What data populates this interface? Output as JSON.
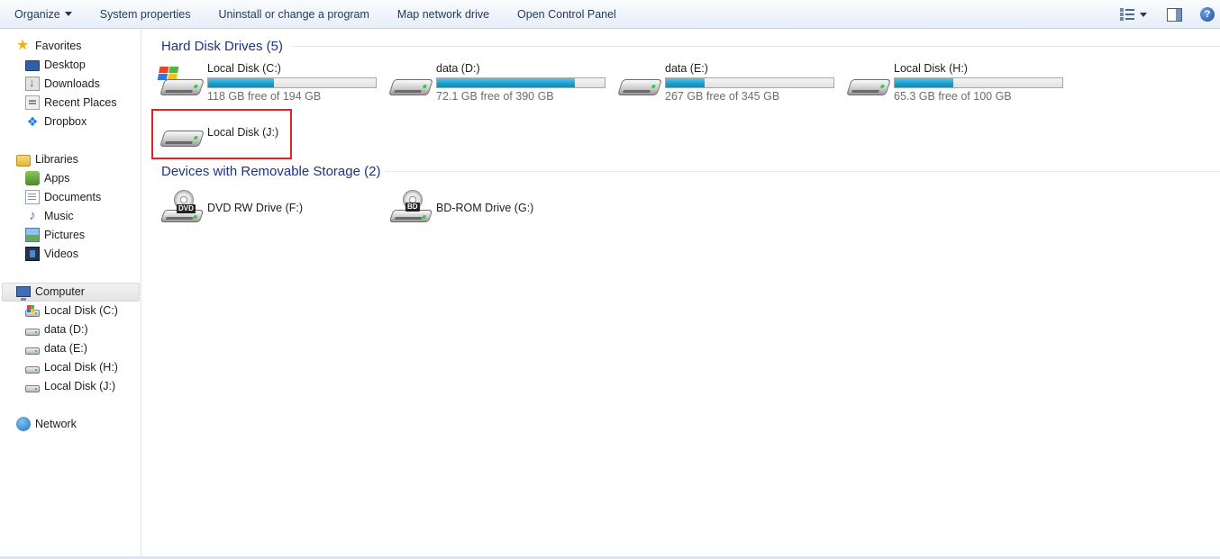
{
  "toolbar": {
    "organize": "Organize",
    "system_properties": "System properties",
    "uninstall": "Uninstall or change a program",
    "map_drive": "Map network drive",
    "control_panel": "Open Control Panel",
    "views_icon": "views-icon",
    "preview_icon": "preview-pane-icon",
    "help_icon": "help-icon",
    "help_glyph": "?"
  },
  "nav": {
    "favorites": {
      "label": "Favorites",
      "items": [
        "Desktop",
        "Downloads",
        "Recent Places",
        "Dropbox"
      ]
    },
    "libraries": {
      "label": "Libraries",
      "items": [
        "Apps",
        "Documents",
        "Music",
        "Pictures",
        "Videos"
      ]
    },
    "computer": {
      "label": "Computer",
      "selected": true,
      "items": [
        "Local Disk (C:)",
        "data (D:)",
        "data (E:)",
        "Local Disk (H:)",
        "Local Disk (J:)"
      ]
    },
    "network": {
      "label": "Network"
    }
  },
  "content": {
    "hdd_group": {
      "title": "Hard Disk Drives (5)",
      "drives": [
        {
          "name": "Local Disk (C:)",
          "free": "118 GB free of 194 GB",
          "used_fraction": 0.39,
          "system": true
        },
        {
          "name": "data (D:)",
          "free": "72.1 GB free of 390 GB",
          "used_fraction": 0.82
        },
        {
          "name": "data (E:)",
          "free": "267 GB free of 345 GB",
          "used_fraction": 0.23
        },
        {
          "name": "Local Disk (H:)",
          "free": "65.3 GB free of 100 GB",
          "used_fraction": 0.35
        },
        {
          "name": "Local Disk (J:)",
          "free": "",
          "highlighted": true
        }
      ]
    },
    "removable_group": {
      "title": "Devices with Removable Storage (2)",
      "devices": [
        {
          "name": "DVD RW Drive (F:)",
          "badge": "DVD"
        },
        {
          "name": "BD-ROM Drive (G:)",
          "badge": "BD"
        }
      ]
    }
  },
  "colors": {
    "group_header": "#1e3287",
    "bar_fill": "#1e9bc8",
    "highlight": "#e02424"
  }
}
